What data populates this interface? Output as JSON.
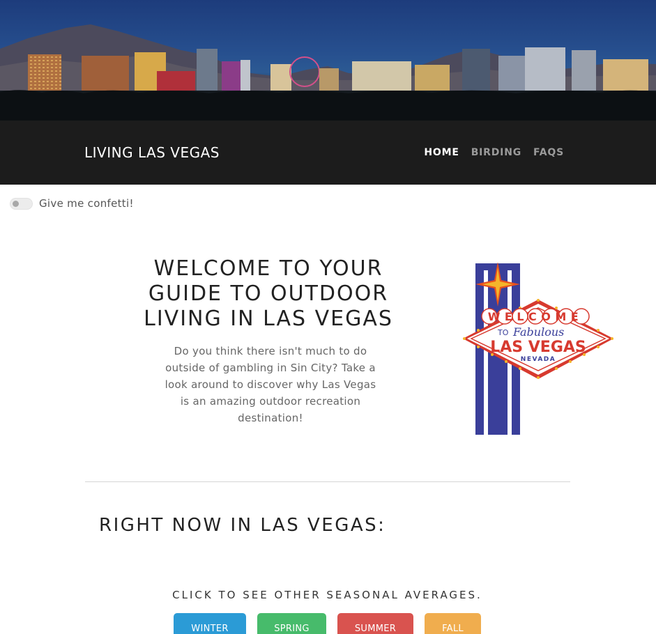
{
  "navbar": {
    "brand": "LIVING LAS VEGAS",
    "links": [
      {
        "label": "HOME",
        "active": true
      },
      {
        "label": "BIRDING",
        "active": false
      },
      {
        "label": "FAQS",
        "active": false
      }
    ]
  },
  "confetti_toggle": {
    "label": "Give me confetti!",
    "checked": false
  },
  "welcome": {
    "title": "WELCOME TO YOUR GUIDE TO OUTDOOR LIVING IN LAS VEGAS",
    "text": "Do you think there isn't much to do outside of gambling in Sin City? Take a look around to discover why Las Vegas is an amazing outdoor recreation destination!"
  },
  "sign": {
    "line1": "WELCOME",
    "line2_small": "TO",
    "line2_script": "Fabulous",
    "line3": "LAS VEGAS",
    "line4": "NEVADA"
  },
  "right_now": {
    "heading": "RIGHT NOW IN LAS VEGAS:"
  },
  "seasonal": {
    "prompt": "CLICK TO SEE OTHER SEASONAL AVERAGES.",
    "buttons": [
      {
        "label": "WINTER",
        "color": "#2b9bd6"
      },
      {
        "label": "SPRING",
        "color": "#47bb6b"
      },
      {
        "label": "SUMMER",
        "color": "#d9534f"
      },
      {
        "label": "FALL",
        "color": "#f0ad4e"
      }
    ]
  }
}
